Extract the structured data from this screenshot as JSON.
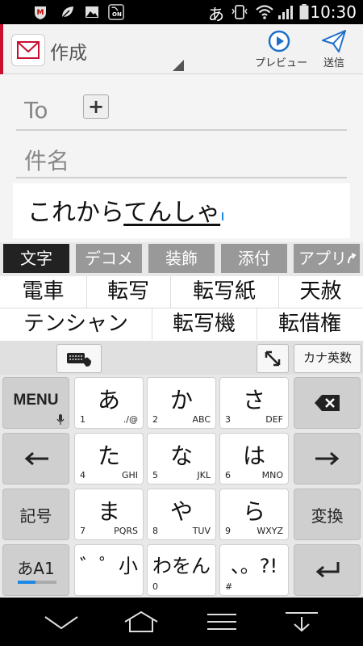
{
  "status_bar": {
    "time": "10:30",
    "ime_indicator": "あ",
    "icons": [
      "mcafee-icon",
      "leaf-icon",
      "image-icon",
      "nfc-on-icon",
      "vibrate-icon",
      "wifi-icon",
      "signal-icon",
      "battery-icon"
    ],
    "nfc_label": "ON"
  },
  "app_bar": {
    "title": "作成",
    "preview_label": "プレビュー",
    "send_label": "送信",
    "accent_color": "#c8102e",
    "preview_color": "#1e6fc9",
    "send_color": "#1e6fc9"
  },
  "form": {
    "to_label": "To",
    "add_label": "+",
    "subject_placeholder": "件名",
    "body_committed": "これから",
    "body_composing": "てんしゃ"
  },
  "keyboard": {
    "tabs": [
      {
        "label": "文字",
        "active": true
      },
      {
        "label": "デコメ",
        "active": false
      },
      {
        "label": "装飾",
        "active": false
      },
      {
        "label": "添付",
        "active": false
      },
      {
        "label": "アプリ",
        "active": false
      }
    ],
    "candidates_row1": [
      "電車",
      "転写",
      "転写紙",
      "天赦"
    ],
    "candidates_row2": [
      "テンシャン",
      "転写機",
      "転借権"
    ],
    "kana_eisu_label": "カナ英数",
    "menu_label": "MENU",
    "kigou_label": "記号",
    "henkan_label": "変換",
    "mode_label": "あA1",
    "keys": [
      {
        "main": "あ",
        "num": "1",
        "alt": "./@"
      },
      {
        "main": "か",
        "num": "2",
        "alt": "ABC"
      },
      {
        "main": "さ",
        "num": "3",
        "alt": "DEF"
      },
      {
        "main": "た",
        "num": "4",
        "alt": "GHI"
      },
      {
        "main": "な",
        "num": "5",
        "alt": "JKL"
      },
      {
        "main": "は",
        "num": "6",
        "alt": "MNO"
      },
      {
        "main": "ま",
        "num": "7",
        "alt": "PQRS"
      },
      {
        "main": "や",
        "num": "8",
        "alt": "TUV"
      },
      {
        "main": "ら",
        "num": "9",
        "alt": "WXYZ"
      },
      {
        "main": "゛゜小",
        "num": "",
        "alt": ""
      },
      {
        "main": "わをん",
        "num": "0",
        "alt": ""
      },
      {
        "main": "、。?!",
        "num": "#",
        "alt": ""
      }
    ],
    "mode_accent": "#1e88e5"
  },
  "nav_bar": {
    "icons": [
      "back-chevron-icon",
      "home-icon",
      "menu-icon",
      "hide-keyboard-icon"
    ]
  }
}
